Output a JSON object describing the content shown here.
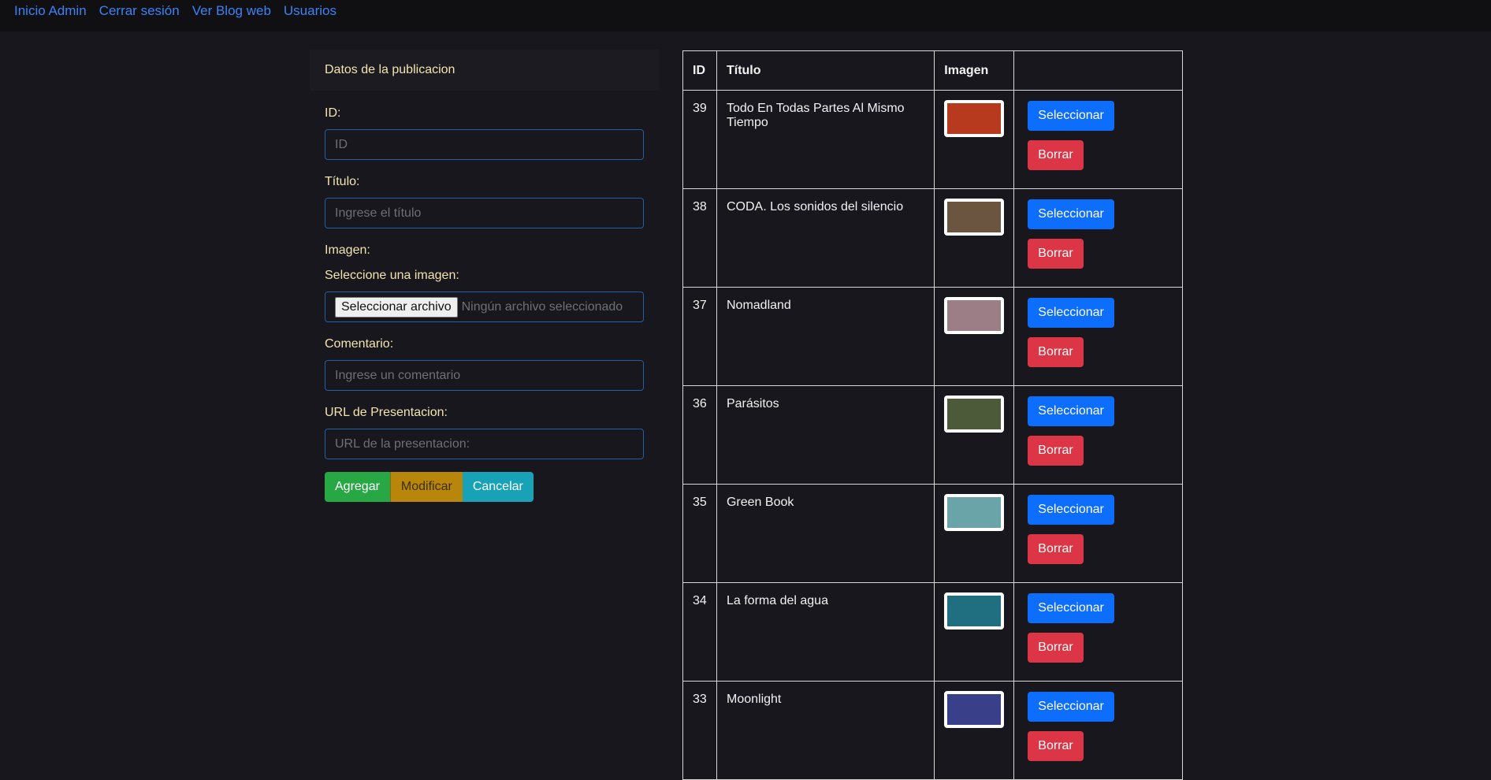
{
  "nav": {
    "links": [
      "Inicio Admin",
      "Cerrar sesión",
      "Ver Blog web",
      "Usuarios"
    ]
  },
  "form": {
    "header": "Datos de la publicacion",
    "id_label": "ID:",
    "id_placeholder": "ID",
    "title_label": "Título:",
    "title_placeholder": "Ingrese el título",
    "image_label": "Imagen:",
    "image_select_label": "Seleccione una imagen:",
    "file_button": "Seleccionar archivo",
    "file_status": "Ningún archivo seleccionado",
    "comment_label": "Comentario:",
    "comment_placeholder": "Ingrese un comentario",
    "url_label": "URL de Presentacion:",
    "url_placeholder": "URL de la presentacion:",
    "add_label": "Agregar",
    "modify_label": "Modificar",
    "cancel_label": "Cancelar"
  },
  "table": {
    "headers": [
      "ID",
      "Título",
      "Imagen",
      ""
    ],
    "select_label": "Seleccionar",
    "delete_label": "Borrar",
    "rows": [
      {
        "id": "39",
        "title": "Todo En Todas Partes Al Mismo Tiempo",
        "thumb_color": "#b83a1e"
      },
      {
        "id": "38",
        "title": "CODA. Los sonidos del silencio",
        "thumb_color": "#6b5440"
      },
      {
        "id": "37",
        "title": "Nomadland",
        "thumb_color": "#9c7f86"
      },
      {
        "id": "36",
        "title": "Parásitos",
        "thumb_color": "#4d5a3a"
      },
      {
        "id": "35",
        "title": "Green Book",
        "thumb_color": "#6aa3a8"
      },
      {
        "id": "34",
        "title": "La forma del agua",
        "thumb_color": "#1f6f80"
      },
      {
        "id": "33",
        "title": "Moonlight",
        "thumb_color": "#3a3f8a"
      }
    ]
  }
}
